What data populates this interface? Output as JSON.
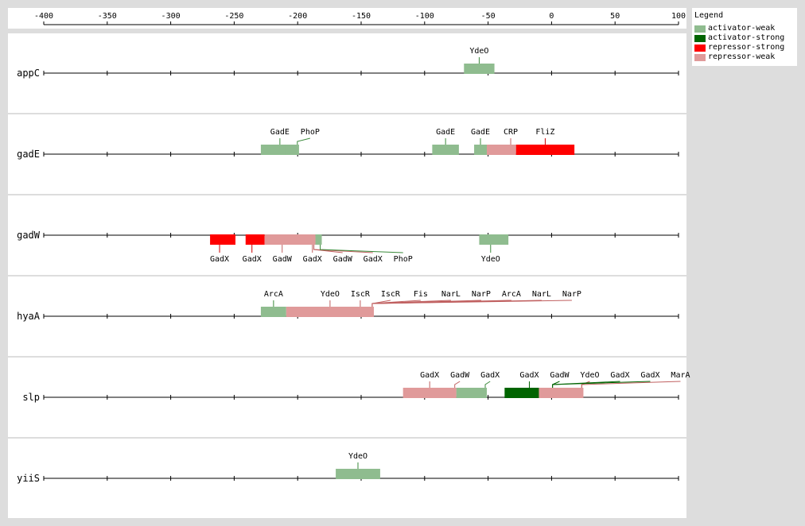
{
  "axis": {
    "ticks": [
      -400,
      -350,
      -300,
      -250,
      -200,
      -150,
      -100,
      -50,
      0,
      50,
      100
    ]
  },
  "colors": {
    "activator-weak": "#8fbc8f",
    "activator-strong": "#006400",
    "repressor-strong": "#ff0000",
    "repressor-weak": "#e09a9a"
  },
  "legend": {
    "title": "Legend",
    "items": [
      {
        "label": "activator-weak",
        "type": "activator-weak"
      },
      {
        "label": "activator-strong",
        "type": "activator-strong"
      },
      {
        "label": "repressor-strong",
        "type": "repressor-strong"
      },
      {
        "label": "repressor-weak",
        "type": "repressor-weak"
      }
    ]
  },
  "genes": [
    {
      "name": "appC",
      "sites": [
        {
          "tf": "YdeO",
          "type": "activator-weak",
          "start": -69,
          "end": -45,
          "labelPos": "above"
        }
      ]
    },
    {
      "name": "gadE",
      "sites": [
        {
          "tf": "GadE",
          "type": "activator-weak",
          "start": -229,
          "end": -199,
          "labelPos": "above"
        },
        {
          "tf": "PhoP",
          "type": "activator-weak",
          "start": -210,
          "end": -199,
          "labelPos": "above"
        },
        {
          "tf": "GadE",
          "type": "activator-weak",
          "start": -94,
          "end": -73,
          "labelPos": "above"
        },
        {
          "tf": "GadE",
          "type": "activator-weak",
          "start": -61,
          "end": -51,
          "labelPos": "above"
        },
        {
          "tf": "CRP",
          "type": "repressor-weak",
          "start": -51,
          "end": -28,
          "labelPos": "above"
        },
        {
          "tf": "FliZ",
          "type": "repressor-strong",
          "start": -28,
          "end": 18,
          "labelPos": "above"
        }
      ]
    },
    {
      "name": "gadW",
      "sites": [
        {
          "tf": "GadX",
          "type": "repressor-strong",
          "start": -269,
          "end": -249,
          "labelPos": "below"
        },
        {
          "tf": "GadX",
          "type": "repressor-strong",
          "start": -241,
          "end": -226,
          "labelPos": "below"
        },
        {
          "tf": "GadW",
          "type": "repressor-weak",
          "start": -226,
          "end": -195,
          "labelPos": "below"
        },
        {
          "tf": "GadX",
          "type": "repressor-weak",
          "start": -219,
          "end": -186,
          "labelPos": "below"
        },
        {
          "tf": "GadW",
          "type": "repressor-weak",
          "start": -212,
          "end": -186,
          "labelPos": "below"
        },
        {
          "tf": "GadX",
          "type": "repressor-weak",
          "start": -205,
          "end": -186,
          "labelPos": "below"
        },
        {
          "tf": "PhoP",
          "type": "activator-weak",
          "start": -186,
          "end": -181,
          "labelPos": "below"
        },
        {
          "tf": "YdeO",
          "type": "activator-weak",
          "start": -57,
          "end": -34,
          "labelPos": "below"
        }
      ]
    },
    {
      "name": "hyaA",
      "sites": [
        {
          "tf": "ArcA",
          "type": "activator-weak",
          "start": -229,
          "end": -209,
          "labelPos": "above"
        },
        {
          "tf": "YdeO",
          "type": "repressor-weak",
          "start": -209,
          "end": -140,
          "labelPos": "above"
        },
        {
          "tf": "IscR",
          "type": "repressor-weak",
          "start": -203,
          "end": -140,
          "labelPos": "above"
        },
        {
          "tf": "IscR",
          "type": "repressor-weak",
          "start": -198,
          "end": -140,
          "labelPos": "above"
        },
        {
          "tf": "Fis",
          "type": "repressor-weak",
          "start": -192,
          "end": -140,
          "labelPos": "above"
        },
        {
          "tf": "NarL",
          "type": "repressor-weak",
          "start": -186,
          "end": -140,
          "labelPos": "above"
        },
        {
          "tf": "NarP",
          "type": "repressor-weak",
          "start": -180,
          "end": -140,
          "labelPos": "above"
        },
        {
          "tf": "ArcA",
          "type": "repressor-weak",
          "start": -175,
          "end": -140,
          "labelPos": "above"
        },
        {
          "tf": "NarL",
          "type": "repressor-weak",
          "start": -169,
          "end": -140,
          "labelPos": "above"
        },
        {
          "tf": "NarP",
          "type": "repressor-weak",
          "start": -163,
          "end": -140,
          "labelPos": "above"
        }
      ]
    },
    {
      "name": "slp",
      "sites": [
        {
          "tf": "GadX",
          "type": "repressor-weak",
          "start": -117,
          "end": -75,
          "labelPos": "above"
        },
        {
          "tf": "GadW",
          "type": "repressor-weak",
          "start": -112,
          "end": -75,
          "labelPos": "above"
        },
        {
          "tf": "GadX",
          "type": "activator-weak",
          "start": -75,
          "end": -51,
          "labelPos": "above"
        },
        {
          "tf": "GadX",
          "type": "activator-strong",
          "start": -37,
          "end": 2,
          "labelPos": "above"
        },
        {
          "tf": "GadW",
          "type": "activator-strong",
          "start": -30,
          "end": 2,
          "labelPos": "above"
        },
        {
          "tf": "YdeO",
          "type": "repressor-weak",
          "start": 5,
          "end": 25,
          "labelPos": "above"
        },
        {
          "tf": "GadX",
          "type": "activator-strong",
          "start": -25,
          "end": 2,
          "labelPos": "above"
        },
        {
          "tf": "GadX",
          "type": "activator-strong",
          "start": -18,
          "end": 2,
          "labelPos": "above"
        },
        {
          "tf": "MarA",
          "type": "repressor-weak",
          "start": -10,
          "end": 25,
          "labelPos": "above"
        }
      ]
    },
    {
      "name": "yiiS",
      "sites": [
        {
          "tf": "YdeO",
          "type": "activator-weak",
          "start": -170,
          "end": -135,
          "labelPos": "above"
        }
      ]
    }
  ]
}
